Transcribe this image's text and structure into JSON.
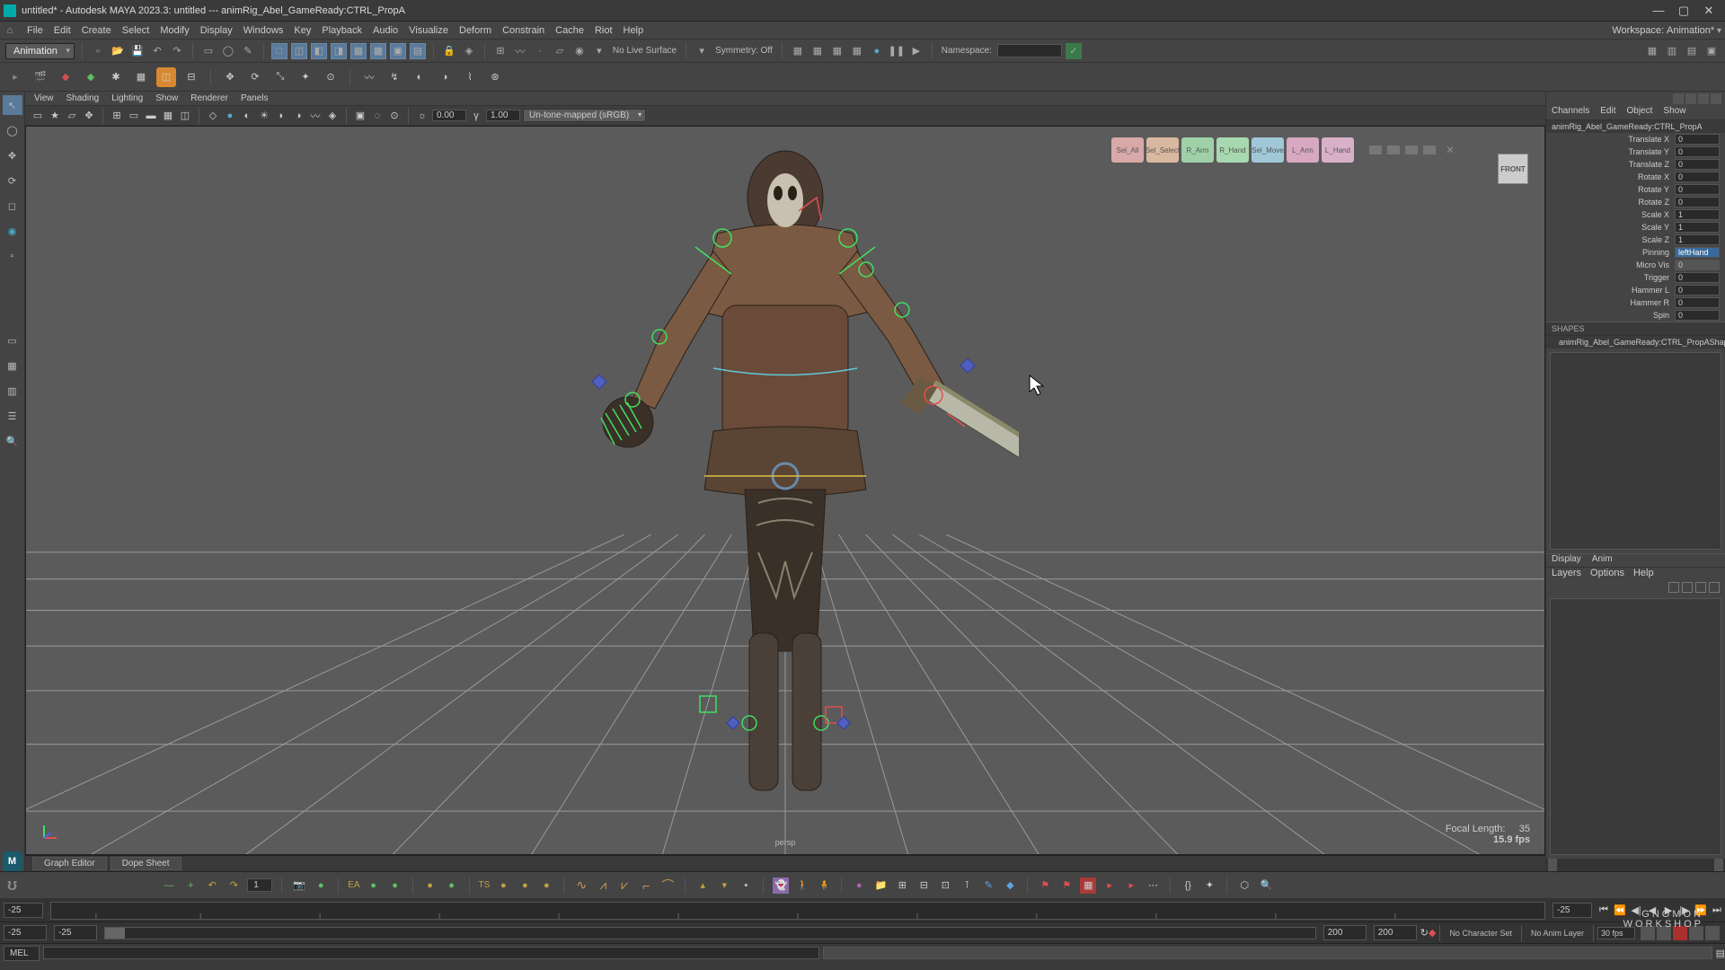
{
  "title": "untitled* - Autodesk MAYA 2023.3: untitled  ---  animRig_Abel_GameReady:CTRL_PropA",
  "menus": [
    "File",
    "Edit",
    "Create",
    "Select",
    "Modify",
    "Display",
    "Windows",
    "Key",
    "Playback",
    "Audio",
    "Visualize",
    "Deform",
    "Constrain",
    "Cache",
    "Riot",
    "Help"
  ],
  "workspace_label": "Workspace:",
  "workspace_value": "Animation*",
  "module": "Animation",
  "status_text_live": "No Live Surface",
  "symmetry": "Symmetry: Off",
  "namespace_label": "Namespace:",
  "vp_menus": [
    "View",
    "Shading",
    "Lighting",
    "Show",
    "Renderer",
    "Panels"
  ],
  "vp_num1": "0.00",
  "vp_num2": "1.00",
  "vp_colorspace": "Un-tone-mapped (sRGB)",
  "viewcube": "FRONT",
  "focal_label": "Focal Length:",
  "focal_val": "35",
  "fps_hud": "15.9 fps",
  "camera_name": "persp",
  "hud_btns": [
    {
      "label": "Sel_All",
      "bg": "#d9a8a8"
    },
    {
      "label": "Sel_Select",
      "bg": "#d9b8a0"
    },
    {
      "label": "R_Arm",
      "bg": "#a0d0a8"
    },
    {
      "label": "R_Hand",
      "bg": "#a8d8b0"
    },
    {
      "label": "Sel_Move",
      "bg": "#a0c8d8"
    },
    {
      "label": "L_Arm",
      "bg": "#d8a8c0"
    },
    {
      "label": "L_Hand",
      "bg": "#d8b0c8"
    }
  ],
  "btabs": [
    "Graph Editor",
    "Dope Sheet"
  ],
  "channel_tabs": [
    "Channels",
    "Edit",
    "Object",
    "Show"
  ],
  "obj_name": "animRig_Abel_GameReady:CTRL_PropA",
  "attrs": [
    {
      "l": "Translate X",
      "v": "0"
    },
    {
      "l": "Translate Y",
      "v": "0"
    },
    {
      "l": "Translate Z",
      "v": "0"
    },
    {
      "l": "Rotate X",
      "v": "0"
    },
    {
      "l": "Rotate Y",
      "v": "0"
    },
    {
      "l": "Rotate Z",
      "v": "0"
    },
    {
      "l": "Scale X",
      "v": "1"
    },
    {
      "l": "Scale Y",
      "v": "1"
    },
    {
      "l": "Scale Z",
      "v": "1"
    },
    {
      "l": "Pinning",
      "v": "leftHand",
      "hl": true
    },
    {
      "l": "Micro Vis",
      "v": "0",
      "fixed": true
    },
    {
      "l": "Trigger",
      "v": "0"
    },
    {
      "l": "Hammer L",
      "v": "0"
    },
    {
      "l": "Hammer R",
      "v": "0"
    },
    {
      "l": "Spin",
      "v": "0"
    }
  ],
  "shapes_label": "SHAPES",
  "shape_name": "animRig_Abel_GameReady:CTRL_PropAShape",
  "disp_tabs": [
    "Display",
    "Anim"
  ],
  "layer_menu": [
    "Layers",
    "Options",
    "Help"
  ],
  "time_start": "-25",
  "time_end": "-25",
  "range_start": "-25",
  "range_inner_start": "-25",
  "range_inner_end": "200",
  "range_end": "200",
  "no_char": "No Character Set",
  "no_anim": "No Anim Layer",
  "fps_field": "30 fps",
  "key_field": "1",
  "ea_label": "EA",
  "ts_label": "TS",
  "mel": "MEL",
  "watermark_l1": "GNOMON",
  "watermark_l2": "WORKSHOP"
}
